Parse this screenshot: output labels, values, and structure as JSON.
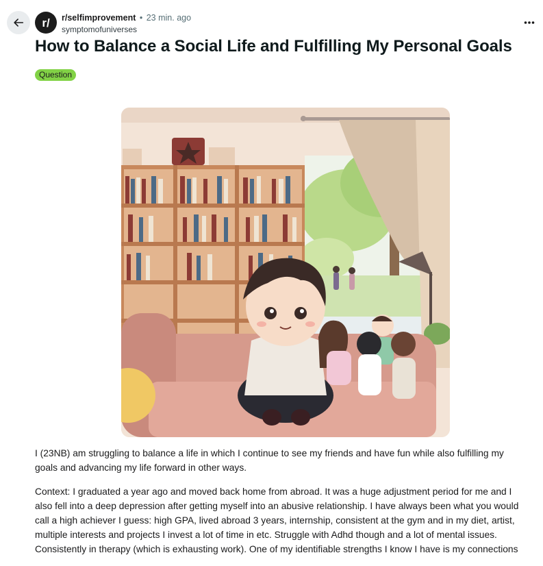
{
  "post": {
    "subreddit": "r/selfimprovement",
    "separator": "•",
    "time_ago": "23 min. ago",
    "author": "symptomofuniverses",
    "title": "How to Balance a Social Life and Fulfilling My Personal Goals",
    "flair": "Question",
    "paragraphs": [
      "I (23NB) am struggling to balance a life in which I continue to see my friends and have fun while also fulfilling my goals and advancing my life forward in other ways.",
      "Context: I graduated a year ago and moved back home from abroad. It was a huge adjustment period for me and I also fell into a deep depression after getting myself into an abusive relationship. I have always been what you would call a high achiever I guess: high GPA, lived abroad 3 years, internship, consistent at the gym and in my diet, artist, multiple interests and projects I invest a lot of time in etc. Struggle with Adhd though and a lot of mental issues. Consistently in therapy (which is exhausting work). One of my identifiable strengths I know I have is my connections"
    ]
  },
  "icons": {
    "back": "arrow-left-icon",
    "subreddit_avatar": "reddit-subreddit-icon",
    "more": "more-horizontal-icon"
  },
  "colors": {
    "flair_bg": "#82d246",
    "back_btn_bg": "#e9ecee",
    "meta_gray": "#576f76"
  }
}
